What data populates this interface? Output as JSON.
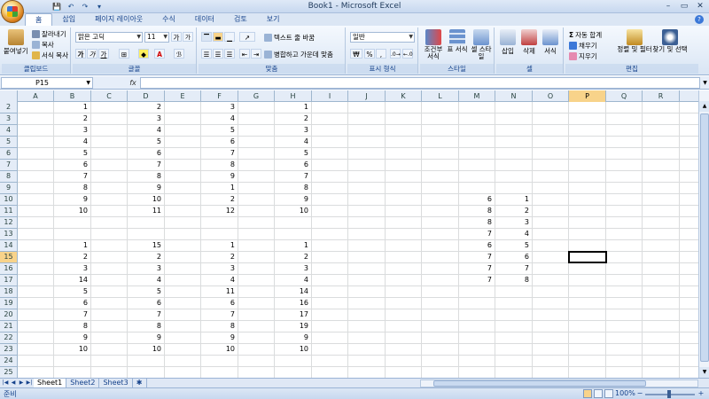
{
  "window": {
    "title": "Book1 - Microsoft Excel",
    "controls": [
      "–",
      "▭",
      "✕"
    ]
  },
  "qat": {
    "save": "💾",
    "undo": "↶",
    "redo": "↷",
    "customize": "▾"
  },
  "tabs": [
    "홈",
    "삽입",
    "페이지 레이아웃",
    "수식",
    "데이터",
    "검토",
    "보기"
  ],
  "active_tab": "홈",
  "ribbon": {
    "clipboard": {
      "paste": "붙여넣기",
      "cut": "잘라내기",
      "copy": "복사",
      "format_painter": "서식 복사",
      "label": "클립보드"
    },
    "font": {
      "name": "맑은 고딕",
      "size": "11",
      "grow": "가",
      "shrink": "가",
      "bold": "가",
      "italic": "가",
      "underline": "가",
      "label": "글꼴"
    },
    "alignment": {
      "wrap": "텍스트 줄 바꿈",
      "merge": "병합하고 가운데 맞춤",
      "label": "맞춤"
    },
    "number": {
      "format": "일반",
      "label": "표시 형식",
      "currency": "₩",
      "percent": "%",
      "comma": ","
    },
    "styles": {
      "conditional": "조건부 서식",
      "table": "표 서식",
      "cell": "셀 스타일",
      "label": "스타일"
    },
    "cells": {
      "insert": "삽입",
      "delete": "삭제",
      "format": "서식",
      "label": "셀"
    },
    "editing": {
      "autosum": "자동 합계",
      "fill": "채우기",
      "clear": "지우기",
      "sort": "정렬 및 필터",
      "find": "찾기 및 선택",
      "label": "편집"
    }
  },
  "formula_bar": {
    "name_box": "P15",
    "fx": "fx",
    "value": ""
  },
  "colors": {
    "accent": "#15428b",
    "header_bg": "#e4ecf7",
    "selected_header": "#f8d38a",
    "grid_line": "#dadcdd"
  },
  "columns": [
    "A",
    "B",
    "C",
    "D",
    "E",
    "F",
    "G",
    "H",
    "I",
    "J",
    "K",
    "L",
    "M",
    "N",
    "O",
    "P",
    "Q",
    "R"
  ],
  "selected_column": "P",
  "selected_row": "15",
  "rows": [
    {
      "n": "2",
      "cells": {
        "B": "1",
        "D": "2",
        "F": "3",
        "H": "1"
      }
    },
    {
      "n": "3",
      "cells": {
        "B": "2",
        "D": "3",
        "F": "4",
        "H": "2"
      }
    },
    {
      "n": "4",
      "cells": {
        "B": "3",
        "D": "4",
        "F": "5",
        "H": "3"
      }
    },
    {
      "n": "5",
      "cells": {
        "B": "4",
        "D": "5",
        "F": "6",
        "H": "4"
      }
    },
    {
      "n": "6",
      "cells": {
        "B": "5",
        "D": "6",
        "F": "7",
        "H": "5"
      }
    },
    {
      "n": "7",
      "cells": {
        "B": "6",
        "D": "7",
        "F": "8",
        "H": "6"
      }
    },
    {
      "n": "8",
      "cells": {
        "B": "7",
        "D": "8",
        "F": "9",
        "H": "7"
      }
    },
    {
      "n": "9",
      "cells": {
        "B": "8",
        "D": "9",
        "F": "1",
        "H": "8"
      }
    },
    {
      "n": "10",
      "cells": {
        "B": "9",
        "D": "10",
        "F": "2",
        "H": "9",
        "M": "6",
        "N": "1"
      }
    },
    {
      "n": "11",
      "cells": {
        "B": "10",
        "D": "11",
        "F": "12",
        "H": "10",
        "M": "8",
        "N": "2"
      }
    },
    {
      "n": "12",
      "cells": {
        "M": "8",
        "N": "3"
      }
    },
    {
      "n": "13",
      "cells": {
        "M": "7",
        "N": "4"
      }
    },
    {
      "n": "14",
      "cells": {
        "B": "1",
        "D": "15",
        "F": "1",
        "H": "1",
        "M": "6",
        "N": "5"
      }
    },
    {
      "n": "15",
      "cells": {
        "B": "2",
        "D": "2",
        "F": "2",
        "H": "2",
        "M": "7",
        "N": "6"
      }
    },
    {
      "n": "16",
      "cells": {
        "B": "3",
        "D": "3",
        "F": "3",
        "H": "3",
        "M": "7",
        "N": "7"
      }
    },
    {
      "n": "17",
      "cells": {
        "B": "14",
        "D": "4",
        "F": "4",
        "H": "4",
        "M": "7",
        "N": "8"
      }
    },
    {
      "n": "18",
      "cells": {
        "B": "5",
        "D": "5",
        "F": "11",
        "H": "14"
      }
    },
    {
      "n": "19",
      "cells": {
        "B": "6",
        "D": "6",
        "F": "6",
        "H": "16"
      }
    },
    {
      "n": "20",
      "cells": {
        "B": "7",
        "D": "7",
        "F": "7",
        "H": "17"
      }
    },
    {
      "n": "21",
      "cells": {
        "B": "8",
        "D": "8",
        "F": "8",
        "H": "19"
      }
    },
    {
      "n": "22",
      "cells": {
        "B": "9",
        "D": "9",
        "F": "9",
        "H": "9"
      }
    },
    {
      "n": "23",
      "cells": {
        "B": "10",
        "D": "10",
        "F": "10",
        "H": "10"
      }
    },
    {
      "n": "24",
      "cells": {}
    },
    {
      "n": "25",
      "cells": {}
    }
  ],
  "sheets": [
    "Sheet1",
    "Sheet2",
    "Sheet3"
  ],
  "active_sheet": "Sheet1",
  "status": {
    "text": "준비",
    "zoom": "100%",
    "minus": "−",
    "plus": "+"
  }
}
